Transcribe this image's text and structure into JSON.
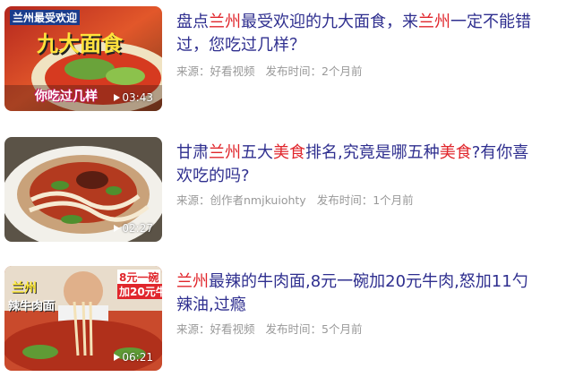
{
  "colors": {
    "title": "#2f2f8f",
    "highlight": "#e0262c",
    "meta": "#999999"
  },
  "items": [
    {
      "title_parts": [
        {
          "t": "盘点",
          "hl": false
        },
        {
          "t": "兰州",
          "hl": true
        },
        {
          "t": "最受欢迎的九大面食，来",
          "hl": false
        },
        {
          "t": "兰州",
          "hl": true
        },
        {
          "t": "一定不能错过，您吃过几样？",
          "hl": false
        }
      ],
      "source": "来源：好看视频",
      "time": "发布时间：2个月前",
      "duration": "03:43",
      "thumb_caption_top": "兰州最受欢迎",
      "thumb_caption_main": "九大面食",
      "thumb_caption_bottom": "你吃过几样"
    },
    {
      "title_parts": [
        {
          "t": "甘肃",
          "hl": false
        },
        {
          "t": "兰州",
          "hl": true
        },
        {
          "t": "五大",
          "hl": false
        },
        {
          "t": "美食",
          "hl": true
        },
        {
          "t": "排名,究竟是哪五种",
          "hl": false
        },
        {
          "t": "美食",
          "hl": true
        },
        {
          "t": "?有你喜欢吃的吗?",
          "hl": false
        }
      ],
      "source": "来源：创作者nmjkuiohty",
      "time": "发布时间：1个月前",
      "duration": "02:27"
    },
    {
      "title_parts": [
        {
          "t": "兰州",
          "hl": true
        },
        {
          "t": "最辣的牛肉面,8元一碗加20元牛肉,怒加11勺辣油,过瘾",
          "hl": false
        }
      ],
      "source": "来源：好看视频",
      "time": "发布时间：5个月前",
      "duration": "06:21",
      "thumb_caption_left1": "兰州",
      "thumb_caption_left2": "辣牛肉面",
      "thumb_caption_right1": "8元一碗",
      "thumb_caption_right2": "加20元牛"
    }
  ]
}
